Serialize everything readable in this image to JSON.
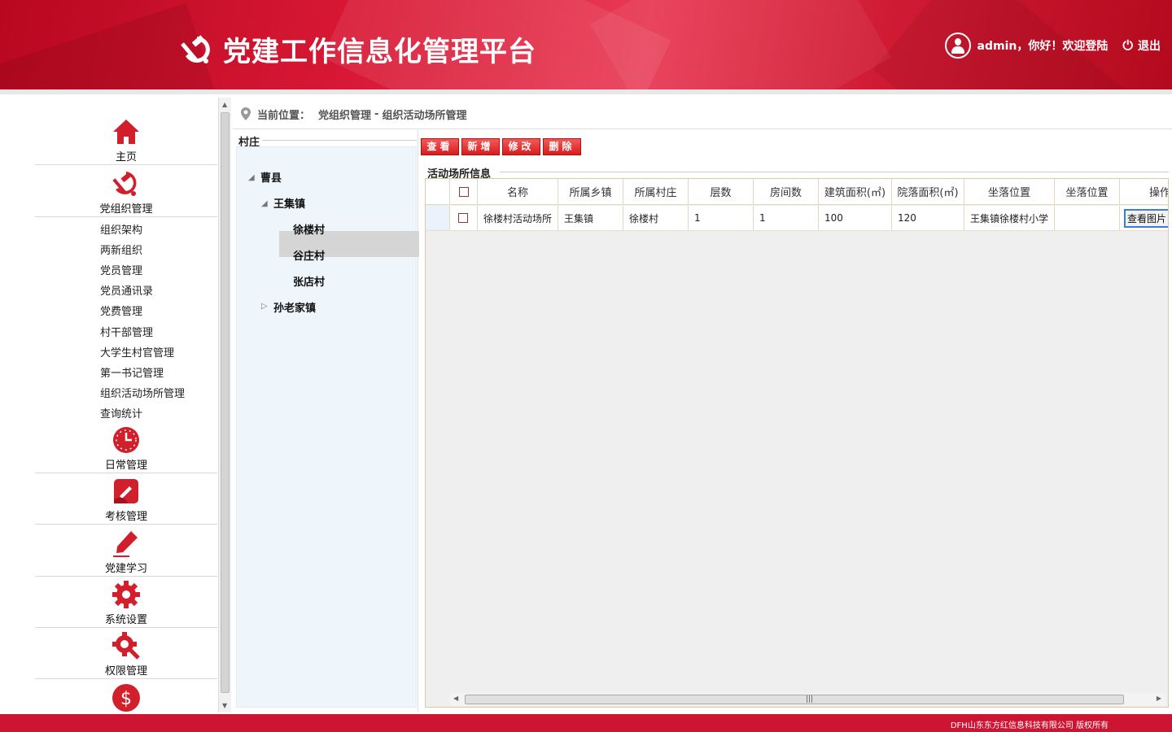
{
  "header": {
    "title": "党建工作信息化管理平台",
    "greeting": "admin，你好！欢迎登陆",
    "logout_label": "退出",
    "power_glyph": "⏻"
  },
  "sidebar": {
    "main_items": [
      {
        "label": "主页",
        "icon": "home-icon"
      },
      {
        "label": "党组织管理",
        "icon": "party-emblem-icon"
      }
    ],
    "sub_items": [
      "组织架构",
      "两新组织",
      "党员管理",
      "党员通讯录",
      "党费管理",
      "村干部管理",
      "大学生村官管理",
      "第一书记管理",
      "组织活动场所管理",
      "查询统计"
    ],
    "more_items": [
      {
        "label": "日常管理",
        "icon": "clock-icon"
      },
      {
        "label": "考核管理",
        "icon": "assessment-icon"
      },
      {
        "label": "党建学习",
        "icon": "pen-icon"
      },
      {
        "label": "系统设置",
        "icon": "gear-icon"
      },
      {
        "label": "权限管理",
        "icon": "gear-wrench-icon"
      },
      {
        "label": "",
        "icon": "dollar-icon"
      }
    ]
  },
  "breadcrumb": {
    "prefix": "当前位置：",
    "section": "党组织管理",
    "separator": "-",
    "page": "组织活动场所管理"
  },
  "tree": {
    "title": "村庄",
    "root": "曹县",
    "town1": "王集镇",
    "villages": [
      "徐楼村",
      "谷庄村",
      "张店村"
    ],
    "town2": "孙老家镇",
    "expanded_glyph": "◢",
    "collapsed_glyph": "▷"
  },
  "toolbar": {
    "view_label": "查看",
    "add_label": "新增",
    "edit_label": "修改",
    "delete_label": "删除"
  },
  "grid": {
    "section_title": "活动场所信息",
    "columns": [
      "名称",
      "所属乡镇",
      "所属村庄",
      "层数",
      "房间数",
      "建筑面积(㎡)",
      "院落面积(㎡)",
      "坐落位置",
      "坐落位置",
      "操作"
    ],
    "rows": [
      {
        "name": "徐楼村活动场所",
        "town": "王集镇",
        "village": "徐楼村",
        "floors": "1",
        "rooms": "1",
        "building_area": "100",
        "yard_area": "120",
        "location": "王集镇徐楼村小学",
        "location2": "",
        "action": "查看图片"
      }
    ],
    "scroll_grip": "|||"
  },
  "footer": {
    "copyright": "DFH山东东方红信息科技有限公司  版权所有"
  },
  "colors": {
    "brand_red": "#cd1533",
    "button_red": "#e02a2a",
    "tree_bg": "#eef6fc"
  }
}
